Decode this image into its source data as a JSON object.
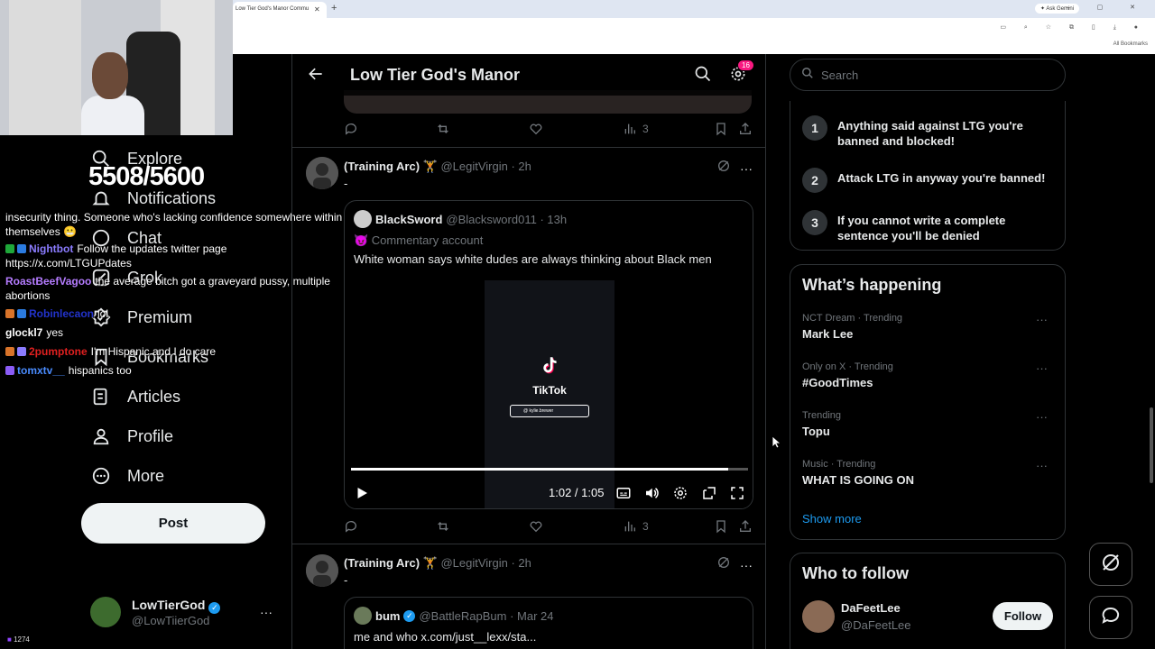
{
  "browser": {
    "tab_title": "Low Tier God's Manor Commu",
    "tab_close": "✕",
    "new_tab": "+",
    "ask_gemini": "✦ Ask Gemini",
    "all_bookmarks": "All Bookmarks",
    "window_controls": "– ▢ ✕"
  },
  "nav": {
    "items": [
      {
        "label": "Explore",
        "icon": "search-icon"
      },
      {
        "label": "Notifications",
        "icon": "bell-icon"
      },
      {
        "label": "Chat",
        "icon": "chat-icon"
      },
      {
        "label": "Grok",
        "icon": "grok-icon"
      },
      {
        "label": "Premium",
        "icon": "x-premium-icon"
      },
      {
        "label": "Bookmarks",
        "icon": "bookmark-icon"
      },
      {
        "label": "Articles",
        "icon": "article-icon"
      },
      {
        "label": "Profile",
        "icon": "person-icon"
      },
      {
        "label": "More",
        "icon": "more-circle-icon"
      }
    ],
    "post_label": "Post",
    "account": {
      "name": "LowTierGod",
      "handle": "@LowTiierGod",
      "more": "···"
    }
  },
  "stream_overlay": {
    "counter": "5508/5600",
    "viewers": "1274",
    "chat": [
      {
        "user": "",
        "user_color": "#ffffff",
        "text": "insecurity thing. Someone who's lacking confidence somewhere within themselves 😬",
        "badges": []
      },
      {
        "user": "Nightbot",
        "user_color": "#8b7cff",
        "text": "Follow the updates twitter page https://x.com/LTGUPdates",
        "badges": [
          "#1fa83a",
          "#2b7be0"
        ]
      },
      {
        "user": "RoastBeefVagoo",
        "user_color": "#b57cff",
        "text": "the average bitch got a graveyard pussy, multiple abortions",
        "badges": []
      },
      {
        "user": "Robinlecaon",
        "user_color": "#2233cc",
        "text": "lol",
        "badges": [
          "#d9742a",
          "#2b7be0"
        ]
      },
      {
        "user": "glockl7",
        "user_color": "#ffffff",
        "text": "yes",
        "badges": []
      },
      {
        "user": "2pumptone",
        "user_color": "#e02020",
        "text": "I'm Hispanic and I do care",
        "badges": [
          "#d9742a",
          "#8b7cff"
        ]
      },
      {
        "user": "tomxtv__",
        "user_color": "#4a8cff",
        "text": "hispanics too",
        "badges": [
          "#8b5cf6"
        ]
      }
    ]
  },
  "header": {
    "title": "Low Tier God's Manor",
    "notif_count": "16"
  },
  "prev_post": {
    "views": "3"
  },
  "posts": [
    {
      "author": "(Training Arc) 🏋",
      "handle": "@LegitVirgin",
      "time": "· 2h",
      "text": "-",
      "quote": {
        "author": "BlackSword",
        "handle": "@Blacksword011",
        "time": "· 13h",
        "label": "😈 Commentary account",
        "text": "White woman says white dudes are always thinking about Black men",
        "video": {
          "platform": "TikTok",
          "username": "@ kylie.brewer",
          "time": "1:02 / 1:05",
          "progress": 0.95
        }
      },
      "views": "3"
    },
    {
      "author": "(Training Arc) 🏋",
      "handle": "@LegitVirgin",
      "time": "· 2h",
      "text": "-",
      "quote": {
        "author": "bum",
        "handle": "@BattleRapBum",
        "time": "· Mar 24",
        "text": "me and who  x.com/just__lexx/sta..."
      }
    }
  ],
  "sidebar": {
    "search_placeholder": "Search",
    "rules": [
      {
        "num": "1",
        "text": "Anything said against LTG you're banned and blocked!"
      },
      {
        "num": "2",
        "text": "Attack LTG in anyway you're banned!"
      },
      {
        "num": "3",
        "text": "If you cannot write a complete sentence you'll be denied"
      }
    ],
    "trending_title": "What’s happening",
    "trends": [
      {
        "meta": "NCT Dream · Trending",
        "topic": "Mark Lee"
      },
      {
        "meta": "Only on X · Trending",
        "topic": "#GoodTimes"
      },
      {
        "meta": "Trending",
        "topic": "Topu"
      },
      {
        "meta": "Music · Trending",
        "topic": "WHAT IS GOING ON"
      }
    ],
    "show_more": "Show more",
    "who_to_follow": "Who to follow",
    "follow": {
      "name": "DaFeetLee",
      "handle": "@DaFeetLee",
      "button": "Follow"
    }
  },
  "colors": {
    "accent": "#1d9bf0",
    "badge": "#f91880",
    "border": "#2f3336",
    "muted": "#71767b"
  }
}
